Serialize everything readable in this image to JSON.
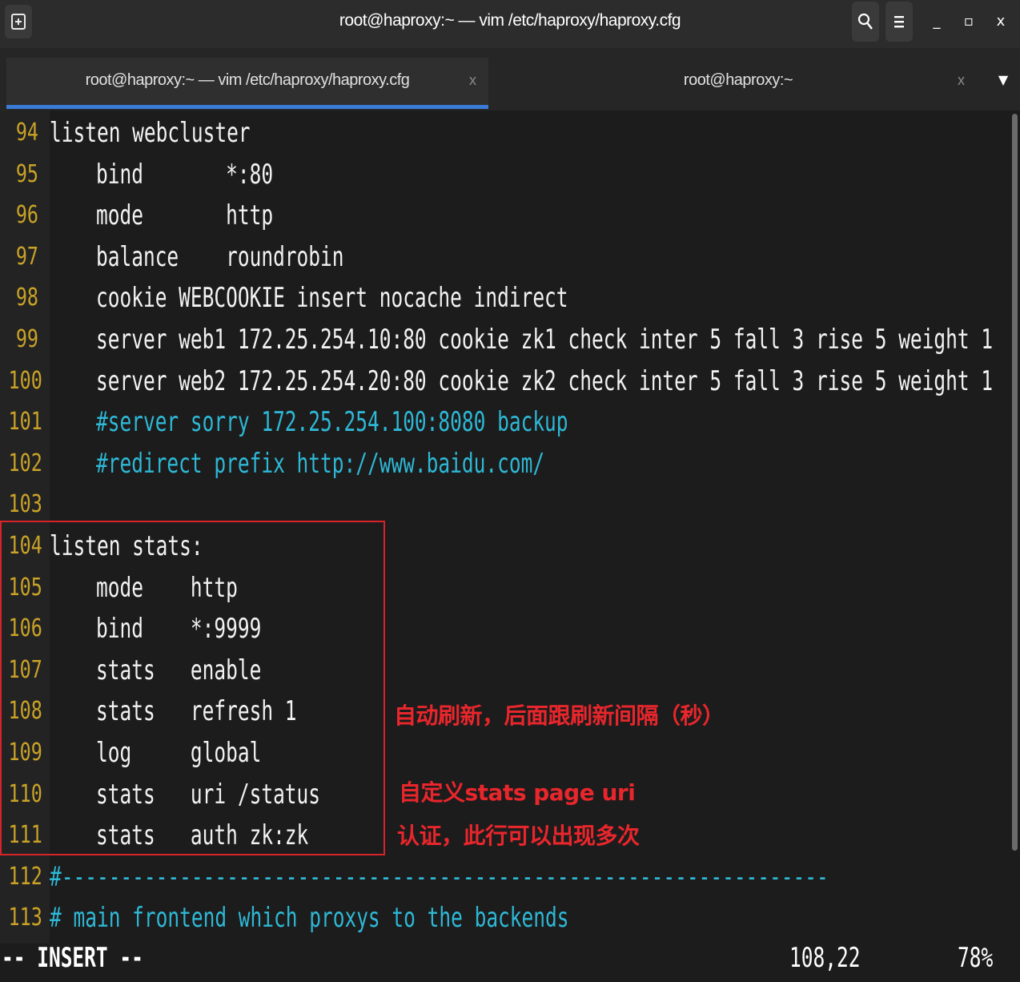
{
  "window": {
    "title": "root@haproxy:~ — vim /etc/haproxy/haproxy.cfg"
  },
  "tabs": [
    {
      "label": "root@haproxy:~ — vim /etc/haproxy/haproxy.cfg",
      "close": "x"
    },
    {
      "label": "root@haproxy:~",
      "close": "x"
    }
  ],
  "window_controls": {
    "minimize": "_",
    "maximize": "▫",
    "close": "x"
  },
  "editor": {
    "lines": [
      {
        "n": "94",
        "text": "listen webcluster",
        "indent": false,
        "comment": false
      },
      {
        "n": "95",
        "text": "bind       *:80",
        "indent": true,
        "comment": false
      },
      {
        "n": "96",
        "text": "mode       http",
        "indent": true,
        "comment": false
      },
      {
        "n": "97",
        "text": "balance    roundrobin",
        "indent": true,
        "comment": false
      },
      {
        "n": "98",
        "text": "cookie WEBCOOKIE insert nocache indirect",
        "indent": true,
        "comment": false
      },
      {
        "n": "99",
        "text": "server web1 172.25.254.10:80 cookie zk1 check inter 5 fall 3 rise 5 weight 1",
        "indent": true,
        "comment": false
      },
      {
        "n": "100",
        "text": "server web2 172.25.254.20:80 cookie zk2 check inter 5 fall 3 rise 5 weight 1",
        "indent": true,
        "comment": false
      },
      {
        "n": "101",
        "text": "#server sorry 172.25.254.100:8080 backup",
        "indent": true,
        "comment": true
      },
      {
        "n": "102",
        "text": "#redirect prefix http://www.baidu.com/",
        "indent": true,
        "comment": true
      },
      {
        "n": "103",
        "text": "",
        "indent": false,
        "comment": false
      },
      {
        "n": "104",
        "text": "listen stats:",
        "indent": false,
        "comment": false
      },
      {
        "n": "105",
        "text": "mode    http",
        "indent": true,
        "comment": false
      },
      {
        "n": "106",
        "text": "bind    *:9999",
        "indent": true,
        "comment": false
      },
      {
        "n": "107",
        "text": "stats   enable",
        "indent": true,
        "comment": false
      },
      {
        "n": "108",
        "text": "stats   refresh 1",
        "indent": true,
        "comment": false
      },
      {
        "n": "109",
        "text": "log     global",
        "indent": true,
        "comment": false
      },
      {
        "n": "110",
        "text": "stats   uri /status",
        "indent": true,
        "comment": false
      },
      {
        "n": "111",
        "text": "stats   auth zk:zk",
        "indent": true,
        "comment": false
      },
      {
        "n": "112",
        "text": "#-----------------------------------------------------------------",
        "indent": false,
        "comment": true
      },
      {
        "n": "113",
        "text": "# main frontend which proxys to the backends",
        "indent": false,
        "comment": true
      }
    ]
  },
  "annotations": {
    "refresh": "自动刷新，后面跟刷新间隔（秒）",
    "uri": "自定义stats page uri",
    "auth": "认证，此行可以出现多次"
  },
  "statusline": {
    "mode": "-- INSERT --",
    "position": "108,22",
    "percent": "78%"
  },
  "colors": {
    "line_number": "#c9a227",
    "comment": "#2eb8d6",
    "text": "#f2f2f2",
    "highlight": "#d9232b",
    "tab_active": "#3a7bd5"
  }
}
